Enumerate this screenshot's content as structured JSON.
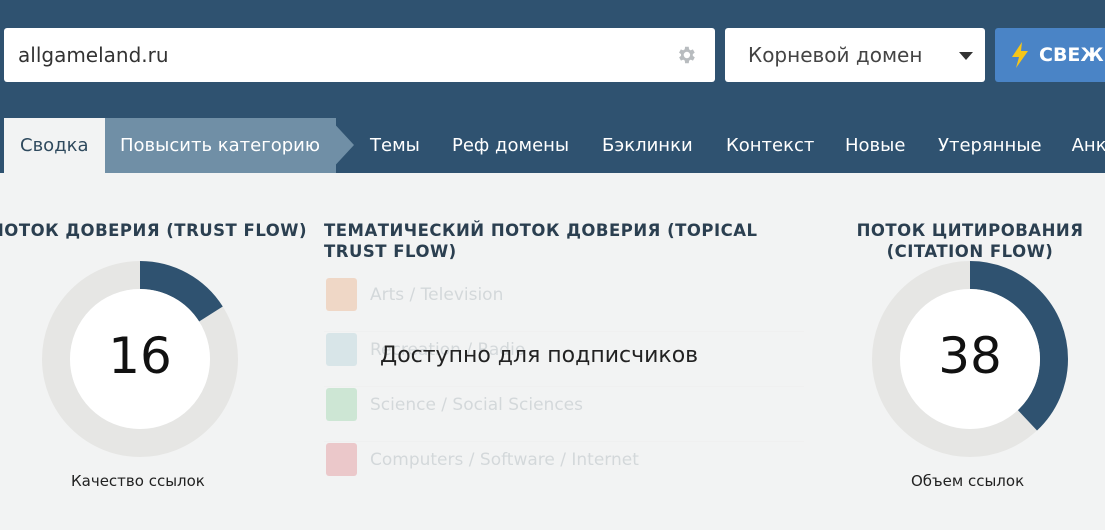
{
  "search": {
    "value": "allgameland.ru"
  },
  "scope_select": {
    "selected": "Корневой домен"
  },
  "fresh_button": {
    "label": "СВЕЖИЙ"
  },
  "tabs": [
    {
      "label": "Сводка",
      "active": true
    },
    {
      "label": "Повысить категорию"
    },
    {
      "label": "Темы"
    },
    {
      "label": "Реф домены"
    },
    {
      "label": "Бэклинки"
    },
    {
      "label": "Контекст"
    },
    {
      "label": "Новые"
    },
    {
      "label": "Утерянные"
    },
    {
      "label": "Анкоры"
    }
  ],
  "trust_flow": {
    "title": "ПОТОК ДОВЕРИЯ (TRUST FLOW)",
    "value": "16",
    "percent": 16,
    "caption": "Качество ссылок"
  },
  "topical": {
    "title_line1": "ТЕМАТИЧЕСКИЙ ПОТОК ДОВЕРИЯ (TOPICAL",
    "title_line2": "TRUST FLOW)",
    "topics": [
      {
        "label": "Arts / Television",
        "color": "#e8792b"
      },
      {
        "label": "Recreation / Radio",
        "color": "#7fb8c4"
      },
      {
        "label": "Science / Social Sciences",
        "color": "#4cbb6c"
      },
      {
        "label": "Computers / Software / Internet",
        "color": "#d5333f"
      }
    ],
    "locked_text": "Доступно для подписчиков"
  },
  "citation_flow": {
    "title_line1": "ПОТОК ЦИТИРОВАНИЯ",
    "title_line2": "(CITATION FLOW)",
    "value": "38",
    "percent": 38,
    "caption": "Объем ссылок"
  },
  "colors": {
    "header": "#2f5270",
    "gauge_fill": "#2f5270",
    "gauge_track": "#e6e6e4",
    "button": "#4a84c6"
  }
}
